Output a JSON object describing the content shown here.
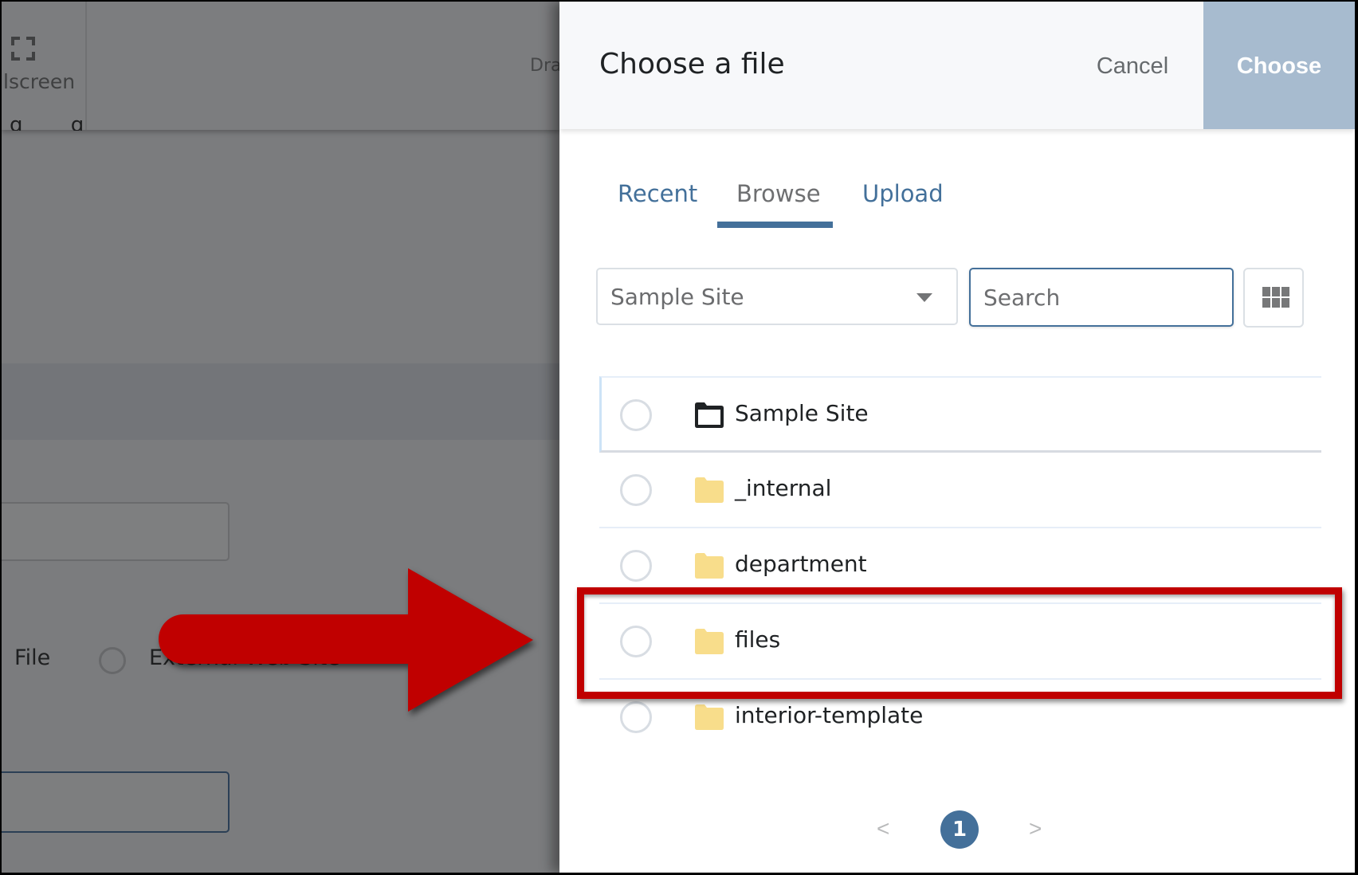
{
  "background": {
    "toolbar": {
      "fullscreen_icon": "fullscreen-icon",
      "fullscreen_label": "lscreen",
      "drag_label": "Dra"
    },
    "partial_text": "g g",
    "link_type": {
      "option_file": "File",
      "option_external": "External Web Site"
    }
  },
  "annotation": {
    "arrow_color": "#c00000",
    "highlight_color": "#c00000",
    "highlighted_item": "files"
  },
  "panel": {
    "title": "Choose a file",
    "cancel_label": "Cancel",
    "choose_label": "Choose",
    "choose_color": "#a7bbcf",
    "tabs": [
      {
        "label": "Recent",
        "active": false
      },
      {
        "label": "Browse",
        "active": true
      },
      {
        "label": "Upload",
        "active": false
      }
    ],
    "site_select": {
      "value": "Sample Site",
      "icon": "caret-down-icon"
    },
    "search": {
      "placeholder": "Search",
      "value": ""
    },
    "view_toggle_icon": "grid-view-icon",
    "items": [
      {
        "label": "Sample Site",
        "icon": "folder-outline-icon",
        "selected": false
      },
      {
        "label": "_internal",
        "icon": "folder-icon",
        "selected": false
      },
      {
        "label": "department",
        "icon": "folder-icon",
        "selected": false
      },
      {
        "label": "files",
        "icon": "folder-icon",
        "selected": false
      },
      {
        "label": "interior-template",
        "icon": "folder-icon",
        "selected": false
      }
    ],
    "pagination": {
      "prev": "<",
      "current_page": "1",
      "next": ">"
    },
    "accent_color": "#44709a",
    "folder_color": "#f8dd8b"
  }
}
